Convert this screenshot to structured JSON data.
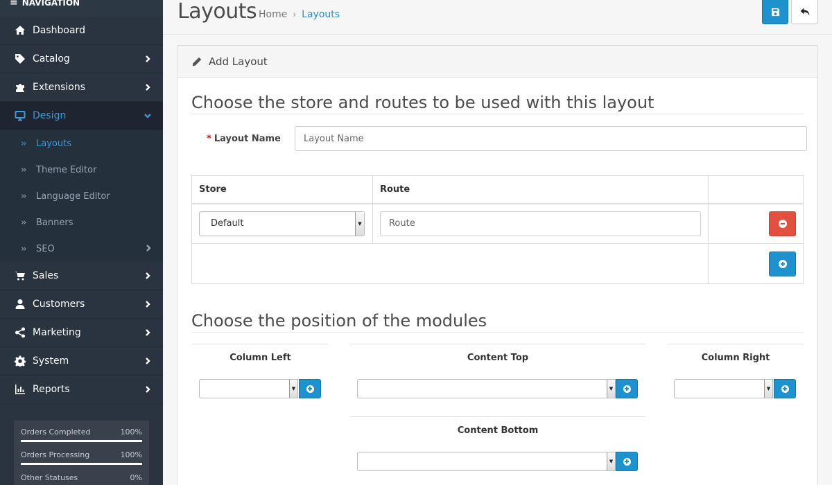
{
  "sidebar": {
    "header": "NAVIGATION",
    "items": [
      {
        "label": "Dashboard",
        "icon": "home-icon"
      },
      {
        "label": "Catalog",
        "icon": "tag-icon"
      },
      {
        "label": "Extensions",
        "icon": "puzzle-icon"
      },
      {
        "label": "Design",
        "icon": "monitor-icon"
      }
    ],
    "design_sub": [
      {
        "label": "Layouts"
      },
      {
        "label": "Theme Editor"
      },
      {
        "label": "Language Editor"
      },
      {
        "label": "Banners"
      },
      {
        "label": "SEO"
      }
    ],
    "items_after": [
      {
        "label": "Sales",
        "icon": "cart-icon"
      },
      {
        "label": "Customers",
        "icon": "user-icon"
      },
      {
        "label": "Marketing",
        "icon": "share-icon"
      },
      {
        "label": "System",
        "icon": "gear-icon"
      },
      {
        "label": "Reports",
        "icon": "bar-chart-icon"
      }
    ],
    "stats": [
      {
        "label": "Orders Completed",
        "value": "100%",
        "fraction": 1.0
      },
      {
        "label": "Orders Processing",
        "value": "100%",
        "fraction": 1.0
      },
      {
        "label": "Other Statuses",
        "value": "0%",
        "fraction": 0.0
      }
    ]
  },
  "header": {
    "title": "Layouts",
    "breadcrumb": {
      "home": "Home",
      "current": "Layouts"
    }
  },
  "panel": {
    "heading": "Add Layout",
    "section1": "Choose the store and routes to be used with this layout",
    "layout_name_label": "Layout Name",
    "layout_name_placeholder": "Layout Name",
    "table": {
      "col_store": "Store",
      "col_route": "Route",
      "store_value": "Default",
      "route_placeholder": "Route"
    },
    "section2": "Choose the position of the modules",
    "positions": {
      "column_left": "Column Left",
      "content_top": "Content Top",
      "column_right": "Column Right",
      "content_bottom": "Content Bottom"
    }
  },
  "colors": {
    "accent": "#1e91cf",
    "danger": "#e3503e",
    "sidebar_bg": "#2a3340"
  }
}
